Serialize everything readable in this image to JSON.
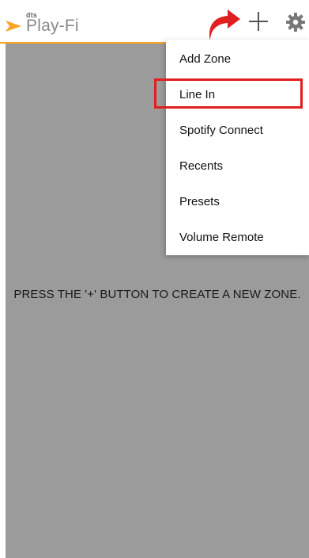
{
  "app": {
    "logo_small": "dts",
    "logo_main": "Play-Fi"
  },
  "colors": {
    "accent": "#f5a623",
    "content_bg": "#9b9b9b",
    "highlight": "#e02020",
    "arrow": "#e02020"
  },
  "icons": {
    "add": "plus-icon",
    "settings": "gear-icon",
    "annotation": "curved-arrow-icon"
  },
  "menu": {
    "items": [
      {
        "label": "Add Zone"
      },
      {
        "label": "Line In"
      },
      {
        "label": "Spotify Connect"
      },
      {
        "label": "Recents"
      },
      {
        "label": "Presets"
      },
      {
        "label": "Volume Remote"
      }
    ],
    "highlighted": "Line In"
  },
  "main": {
    "empty_message": "PRESS THE '+' BUTTON TO CREATE A NEW ZONE."
  }
}
